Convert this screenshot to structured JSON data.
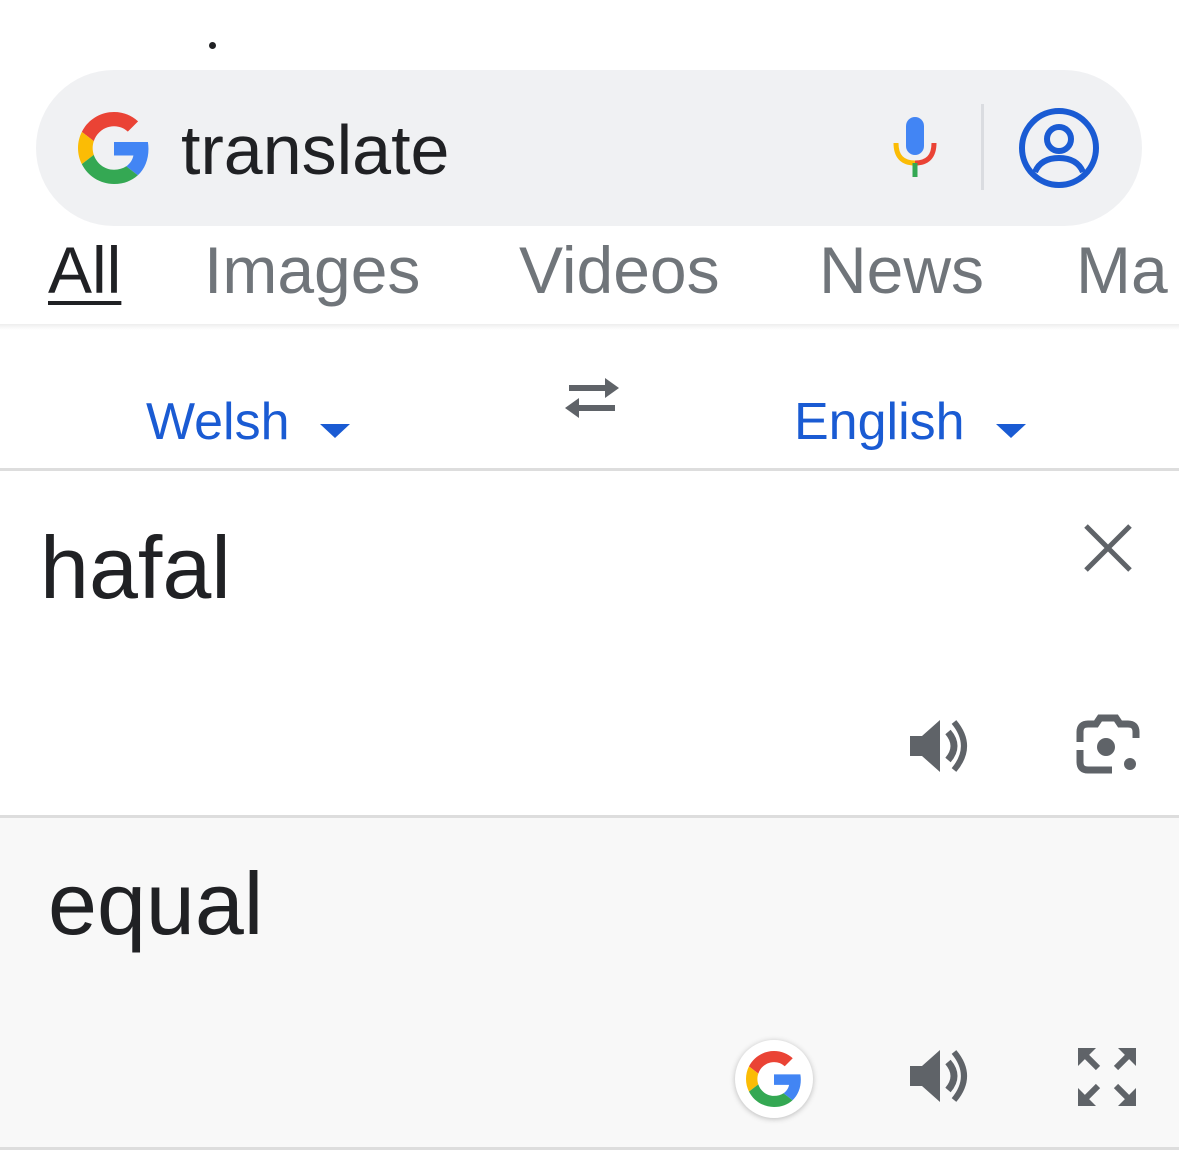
{
  "search": {
    "query": "translate"
  },
  "tabs": [
    {
      "label": "All",
      "active": true
    },
    {
      "label": "Images",
      "active": false
    },
    {
      "label": "Videos",
      "active": false
    },
    {
      "label": "News",
      "active": false
    },
    {
      "label": "Ma",
      "active": false
    }
  ],
  "translator": {
    "source_language": "Welsh",
    "target_language": "English",
    "source_text": "hafal",
    "translated_text": "equal"
  },
  "icons": {
    "google_logo": "google-g-icon",
    "mic": "microphone-icon",
    "account": "account-circle-icon",
    "swap": "swap-arrows-icon",
    "clear": "close-icon",
    "speaker": "speaker-icon",
    "lens": "camera-lens-icon",
    "expand": "fullscreen-icon"
  },
  "colors": {
    "link_blue": "#1a5bd3",
    "text_dark": "#202124",
    "text_grey": "#70757a",
    "google_blue": "#4285f4",
    "google_red": "#ea4335",
    "google_yellow": "#fbbc05",
    "google_green": "#34a853"
  }
}
